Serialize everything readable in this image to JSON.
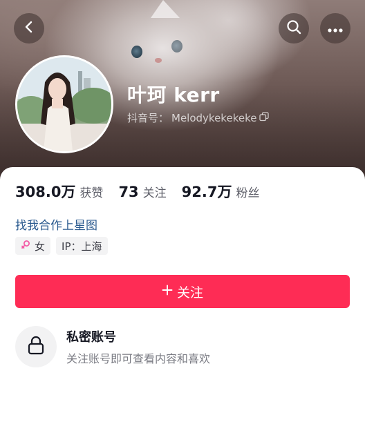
{
  "profile": {
    "display_name": "叶珂 kerr",
    "handle_label": "抖音号：",
    "handle_value": "Melodykekekeke"
  },
  "stats": [
    {
      "value": "308.0万",
      "label": "获赞"
    },
    {
      "value": "73",
      "label": "关注"
    },
    {
      "value": "92.7万",
      "label": "粉丝"
    }
  ],
  "bio": {
    "link_text": "找我合作上星图"
  },
  "tags": {
    "gender_label": "女",
    "ip_label": "IP：上海"
  },
  "actions": {
    "follow_label": "关注"
  },
  "private_account": {
    "title": "私密账号",
    "subtitle": "关注账号即可查看内容和喜欢"
  },
  "icons": {
    "back": "back-chevron-icon",
    "search": "search-icon",
    "more": "more-dots-icon",
    "copy": "copy-icon",
    "female": "female-icon",
    "plus": "plus-icon",
    "lock": "lock-icon"
  },
  "colors": {
    "accent": "#fe2c55",
    "link": "#2a5a8f",
    "female": "#f35aa6"
  }
}
